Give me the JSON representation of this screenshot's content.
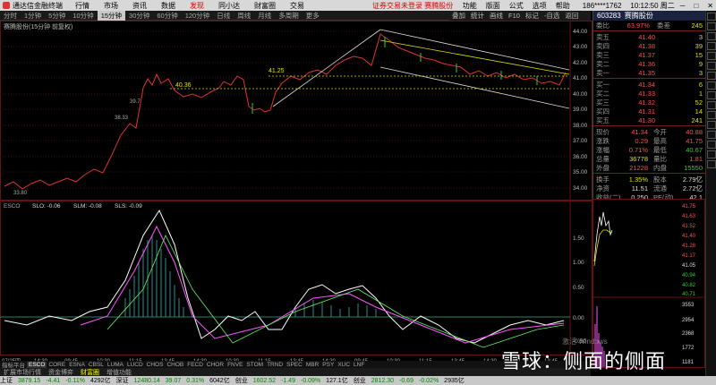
{
  "app": {
    "title": "通达信金融终端",
    "menus": [
      "行情",
      "市场",
      "资讯",
      "数据",
      "发现",
      "同小达",
      "财富圈",
      "交易"
    ],
    "active_menu": "发现",
    "status_text": "证券交易未登录  赛腾股份",
    "right_menus": [
      "功能",
      "版面",
      "公式",
      "选项",
      "帮助"
    ],
    "phone": "186****1762",
    "time": "10:12:50 周二"
  },
  "periods": [
    "分时",
    "1分钟",
    "5分钟",
    "10分钟",
    "15分钟",
    "30分钟",
    "60分钟",
    "120分钟",
    "日线",
    "周线",
    "月线",
    "多周期",
    "更多"
  ],
  "active_period": "15分钟",
  "right_tools": [
    "叠加",
    "统计",
    "画线",
    "F10",
    "标记",
    "-自选",
    "返回"
  ],
  "chart_title": "赛腾股份(15分钟 前复权)",
  "price_labels": {
    "a": "41.25",
    "b": "40.36",
    "c": "39.7",
    "d": "38.33",
    "e": "33.80"
  },
  "price_axis": [
    "44.00",
    "43.00",
    "42.00",
    "41.00",
    "40.00",
    "39.00",
    "38.00",
    "37.00",
    "36.00",
    "35.00",
    "34.00"
  ],
  "indicator": {
    "name": "ESCO",
    "slo": "SLO: -0.06",
    "slm": "SLM: -0.08",
    "sls": "SLS: -0.09"
  },
  "ind_axis": [
    "1.50",
    "1.00",
    "0.50",
    "0.00",
    "-0.50"
  ],
  "time_axis": [
    "07/25四",
    "14:30",
    "09:45",
    "10:30",
    "11:15",
    "13:45",
    "14:30",
    "10:30",
    "11:15",
    "13:45",
    "14:30",
    "09:45",
    "10:30",
    "11:15",
    "13:45",
    "14:30",
    "11:15",
    "13:45",
    "14:30"
  ],
  "ind_tabs": [
    "指标平台",
    "ESCO",
    "CORE",
    "ESNA",
    "CBSL",
    "LUMA",
    "LUCD",
    "CHOS",
    "CHOB",
    "FECD",
    "CHOR",
    "FNVE",
    "STOM",
    "TRND",
    "SPEC",
    "MBR",
    "PSY",
    "XUC",
    "LNF"
  ],
  "active_ind": "ESCO",
  "bottom_tabs": [
    "扩展市场行情",
    "资金博弈",
    "财富圈",
    "增值功能"
  ],
  "quote": {
    "code": "603283",
    "name": "赛腾股份",
    "ratio_label": "委比",
    "ratio": "63.97%",
    "diff_label": "委差",
    "diff": "245",
    "sells": [
      {
        "label": "卖五",
        "price": "41.40",
        "vol": "3"
      },
      {
        "label": "卖四",
        "price": "41.38",
        "vol": "39"
      },
      {
        "label": "卖三",
        "price": "41.37",
        "vol": "15"
      },
      {
        "label": "卖二",
        "price": "41.36",
        "vol": "9"
      },
      {
        "label": "卖一",
        "price": "41.35",
        "vol": "3"
      }
    ],
    "buys": [
      {
        "label": "买一",
        "price": "41.34",
        "vol": "6"
      },
      {
        "label": "买二",
        "price": "41.33",
        "vol": "1"
      },
      {
        "label": "买三",
        "price": "41.32",
        "vol": "52"
      },
      {
        "label": "买四",
        "price": "41.31",
        "vol": "14"
      },
      {
        "label": "买五",
        "price": "41.30",
        "vol": "241"
      }
    ],
    "stats": [
      {
        "k": "现价",
        "v": "41.34",
        "k2": "今开",
        "v2": "40.88"
      },
      {
        "k": "涨跌",
        "v": "0.29",
        "k2": "最高",
        "v2": "41.75"
      },
      {
        "k": "涨幅",
        "v": "0.71%",
        "k2": "最低",
        "v2": "40.67"
      },
      {
        "k": "总量",
        "v": "36778",
        "k2": "量比",
        "v2": "1.81"
      },
      {
        "k": "外盘",
        "v": "21228",
        "k2": "内盘",
        "v2": "15550"
      }
    ],
    "stats2": [
      {
        "k": "换手",
        "v": "1.35%",
        "k2": "股本",
        "v2": "2.79亿"
      },
      {
        "k": "净资",
        "v": "11.51",
        "k2": "流通",
        "v2": "2.72亿"
      },
      {
        "k": "收益(二)",
        "v": "0.250",
        "k2": "PE(动)",
        "v2": "42.1"
      }
    ]
  },
  "mini_axis": [
    "41.75",
    "41.63",
    "41.52",
    "41.40",
    "41.28",
    "41.17",
    "41.05",
    "40.94",
    "40.82",
    "40.71"
  ],
  "mini_vol": [
    "3553",
    "2954",
    "2368",
    "1772",
    "1181"
  ],
  "statusbar": [
    {
      "t": "上证",
      "c": ""
    },
    {
      "t": "3879.15",
      "c": "g"
    },
    {
      "t": "-4.41",
      "c": "g"
    },
    {
      "t": "-0.11%",
      "c": "g"
    },
    {
      "t": "4292亿",
      "c": ""
    },
    {
      "t": "深证",
      "c": ""
    },
    {
      "t": "12480.14",
      "c": "g"
    },
    {
      "t": "39.07",
      "c": "g"
    },
    {
      "t": "0.31%",
      "c": "g"
    },
    {
      "t": "6042亿",
      "c": ""
    },
    {
      "t": "创业",
      "c": ""
    },
    {
      "t": "1602.52",
      "c": "g"
    },
    {
      "t": "-1.49",
      "c": "g"
    },
    {
      "t": "-0.09%",
      "c": "g"
    },
    {
      "t": "127.1亿",
      "c": ""
    },
    {
      "t": "创业",
      "c": ""
    },
    {
      "t": "2812.30",
      "c": "g"
    },
    {
      "t": "-0.69",
      "c": "g"
    },
    {
      "t": "-0.02%",
      "c": "g"
    },
    {
      "t": "2935亿",
      "c": ""
    }
  ],
  "watermark": "雪球：侧面的侧面",
  "win_text": "激活 Windows"
}
